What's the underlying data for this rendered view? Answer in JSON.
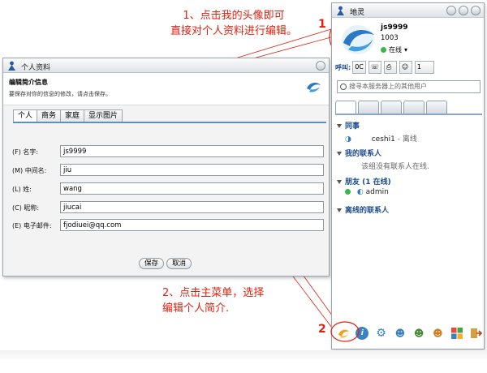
{
  "annotations": {
    "callout1_line1": "1、点击我的头像即可",
    "callout1_line2": "直接对个人资料进行编辑。",
    "callout2_line1": "2、点击主菜单，选择",
    "callout2_line2": "编辑个人简介.",
    "marker1": "1",
    "marker2": "2"
  },
  "dialog": {
    "title": "个人资料",
    "header_title": "编辑简介信息",
    "header_subtitle": "要保存对你的信息的修改，请点击保存。",
    "tabs": [
      "个人",
      "商务",
      "家庭",
      "显示图片"
    ],
    "fields": [
      {
        "label": "(F) 名字:",
        "value": "js9999"
      },
      {
        "label": "(M) 中间名:",
        "value": "jiu"
      },
      {
        "label": "(L) 姓:",
        "value": "wang"
      },
      {
        "label": "(C) 昵称:",
        "value": "jiucai"
      },
      {
        "label": "(E) 电子邮件:",
        "value": "fjodiuei@qq.com"
      }
    ],
    "save_label": "保存",
    "cancel_label": "取消"
  },
  "mainwin": {
    "title": "地灵",
    "username": "js9999",
    "userid": "1003",
    "status": "在线",
    "toolbar": {
      "call_label": "呼叫:",
      "call_value": "0C",
      "count": "1"
    },
    "search_placeholder": "搜寻本服务器上的其他用户",
    "groups": {
      "coworkers": "同事",
      "coworker_contact": "ceshi1",
      "coworker_status": "- 离线",
      "mycontacts": "我的联系人",
      "mycontacts_empty": "该组没有联系人在线.",
      "friends": "朋友 (1 在线)",
      "friend_contact": "admin",
      "offline": "离线的联系人"
    }
  },
  "colors": {
    "callout": "#e02010",
    "accent": "#1a4a8c",
    "online": "#39b54a"
  }
}
